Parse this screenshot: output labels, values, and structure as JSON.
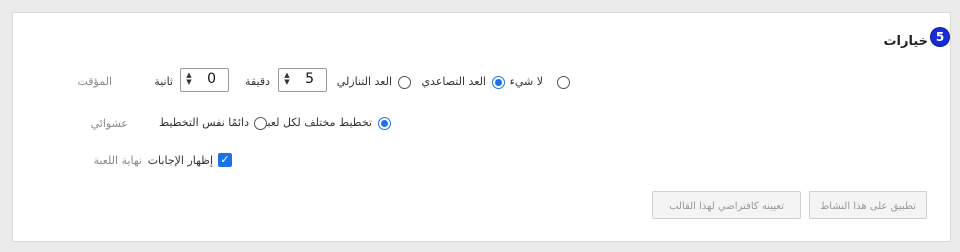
{
  "section": {
    "number": "5",
    "title": "خيارات"
  },
  "timer": {
    "label": "المؤقت",
    "options": [
      {
        "label": "لا شيء",
        "selected": false
      },
      {
        "label": "العد التصاعدي",
        "selected": true
      },
      {
        "label": "العد التنازلي",
        "selected": false
      }
    ],
    "minutes": {
      "value": "5",
      "unit": "دقيقة"
    },
    "seconds": {
      "value": "0",
      "unit": "ثانية"
    }
  },
  "random": {
    "label": "عشوائي",
    "options": [
      {
        "label": "تخطيط مختلف لكل لعبة",
        "selected": true
      },
      {
        "label": "دائمًا نفس التخطيط",
        "selected": false
      }
    ]
  },
  "game_end": {
    "label": "نهاية اللعبة",
    "show_answers": {
      "label": "إظهار الإجابات",
      "checked": true
    }
  },
  "buttons": {
    "apply": "تطبيق على هذا النشاط",
    "set_default": "تعيينه كافتراضي لهذا القالب"
  }
}
